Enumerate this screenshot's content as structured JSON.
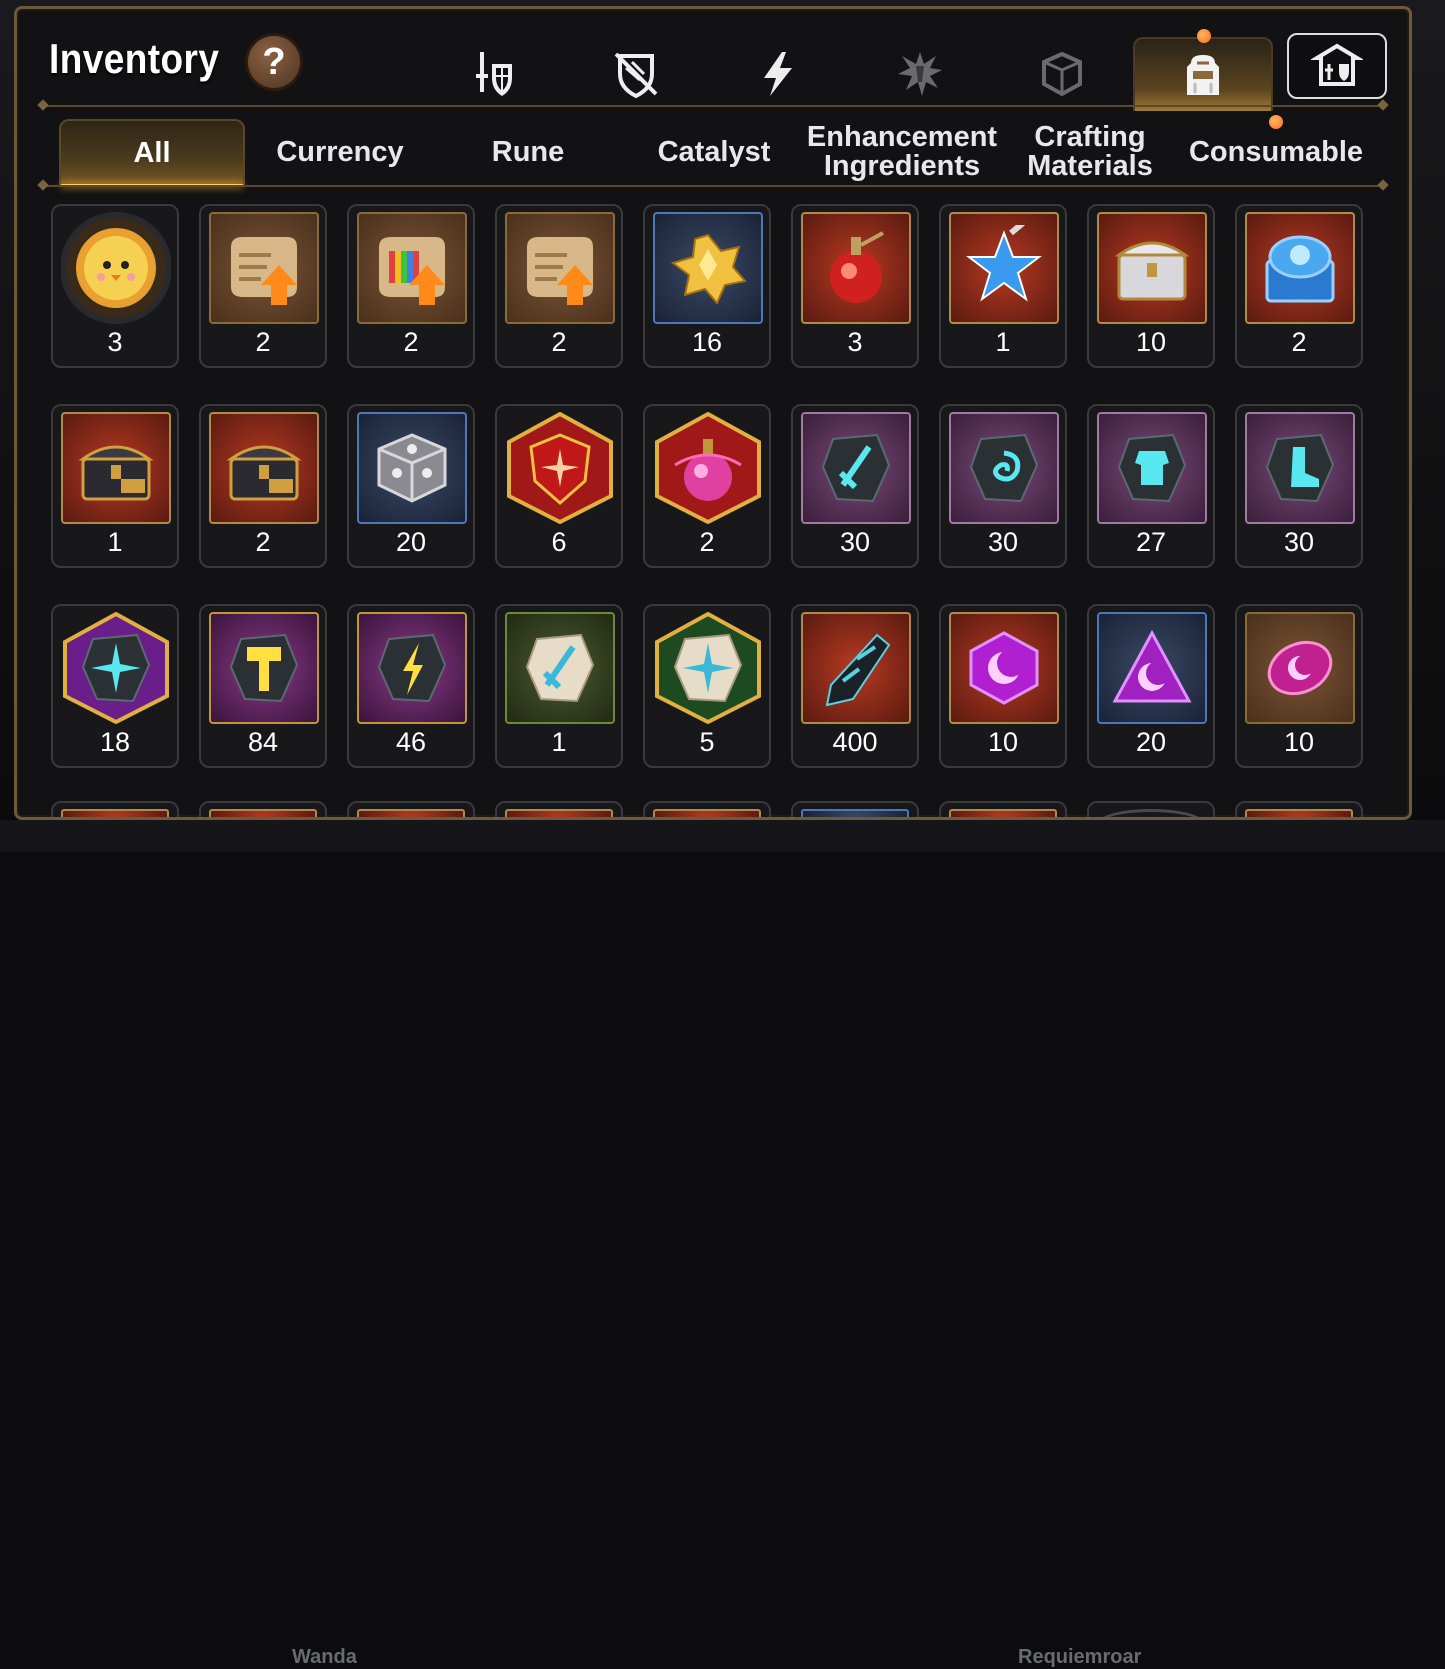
{
  "header": {
    "title": "Inventory",
    "help_label": "?"
  },
  "category_tabs": [
    {
      "icon": "sword-shield-icon",
      "active": false
    },
    {
      "icon": "broken-shield-icon",
      "active": false
    },
    {
      "icon": "lightning-icon",
      "active": false
    },
    {
      "icon": "burst-emblem-icon",
      "active": false
    },
    {
      "icon": "cube-icon",
      "active": false
    },
    {
      "icon": "backpack-icon",
      "active": true,
      "badge": true
    },
    {
      "icon": "guild-castle-icon",
      "active": false
    }
  ],
  "sub_tabs": [
    {
      "label": "All",
      "active": true
    },
    {
      "label": "Currency"
    },
    {
      "label": "Rune"
    },
    {
      "label": "Catalyst"
    },
    {
      "label": "Enhancement Ingredients"
    },
    {
      "label": "Crafting Materials"
    },
    {
      "label": "Consumable",
      "badge": true
    }
  ],
  "items": [
    {
      "icon": "chick-medal-icon",
      "count": "3",
      "frame": "circle"
    },
    {
      "icon": "orange-upgrade-scroll-icon",
      "count": "2",
      "frame": "brown"
    },
    {
      "icon": "rainbow-upgrade-scroll-icon",
      "count": "2",
      "frame": "brown"
    },
    {
      "icon": "orange-upgrade-scroll-icon",
      "count": "2",
      "frame": "brown"
    },
    {
      "icon": "golden-crystal-cluster-icon",
      "count": "16",
      "frame": "blue"
    },
    {
      "icon": "red-potion-icon",
      "count": "3",
      "frame": "red"
    },
    {
      "icon": "blue-star-potion-icon",
      "count": "1",
      "frame": "red"
    },
    {
      "icon": "silver-gold-chest-icon",
      "count": "10",
      "frame": "red"
    },
    {
      "icon": "blue-glowing-chest-icon",
      "count": "2",
      "frame": "red"
    },
    {
      "icon": "dark-gold-chest-icon",
      "count": "1",
      "frame": "red"
    },
    {
      "icon": "dark-gold-chest-icon",
      "count": "2",
      "frame": "red"
    },
    {
      "icon": "silver-cube-icon",
      "count": "20",
      "frame": "blue"
    },
    {
      "icon": "red-gem-shield-icon",
      "count": "6",
      "frame": "hex-red"
    },
    {
      "icon": "pink-chain-potion-icon",
      "count": "2",
      "frame": "hex-red"
    },
    {
      "icon": "sword-rune-stone-icon",
      "count": "30",
      "frame": "purple"
    },
    {
      "icon": "spiral-rune-stone-icon",
      "count": "30",
      "frame": "purple"
    },
    {
      "icon": "armor-rune-stone-icon",
      "count": "27",
      "frame": "purple"
    },
    {
      "icon": "boot-rune-stone-icon",
      "count": "30",
      "frame": "purple"
    },
    {
      "icon": "cross-rune-stone-icon",
      "count": "18",
      "frame": "hex-purple"
    },
    {
      "icon": "hammer-rune-stone-icon",
      "count": "84",
      "frame": "purpleg"
    },
    {
      "icon": "bolt-rune-stone-icon",
      "count": "46",
      "frame": "purpleg"
    },
    {
      "icon": "sword-white-stone-icon",
      "count": "1",
      "frame": "green"
    },
    {
      "icon": "cross-white-stone-icon",
      "count": "5",
      "frame": "hex-green"
    },
    {
      "icon": "dark-crystal-shard-icon",
      "count": "400",
      "frame": "red"
    },
    {
      "icon": "moon-hexagon-gem-icon",
      "count": "10",
      "frame": "red"
    },
    {
      "icon": "moon-triangle-gem-icon",
      "count": "20",
      "frame": "blue"
    },
    {
      "icon": "moon-oval-gem-icon",
      "count": "10",
      "frame": "brown"
    }
  ],
  "background_labels": {
    "left": "Wanda",
    "right": "Requiemroar"
  },
  "colors": {
    "panel_border": "#6e5a3a",
    "active_glow": "#ffcc66",
    "badge": "#ff7a22"
  }
}
